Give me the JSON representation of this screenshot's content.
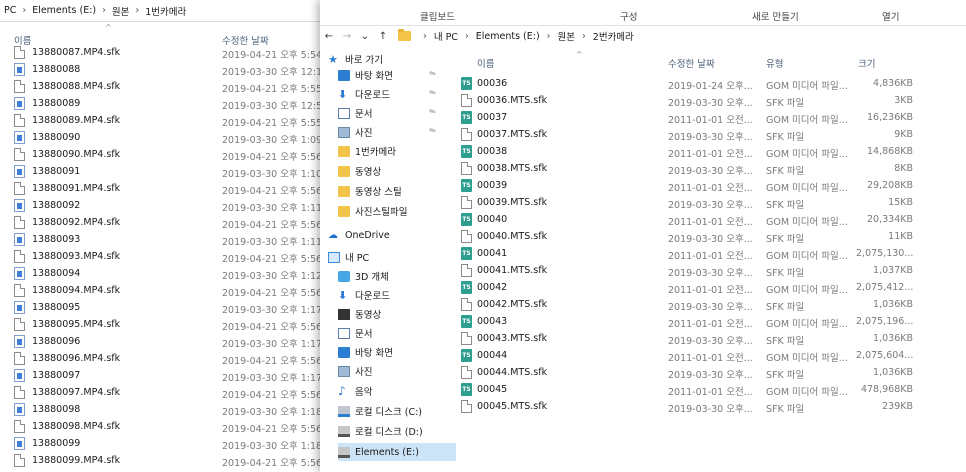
{
  "left_window": {
    "breadcrumb": [
      "PC",
      "Elements (E:)",
      "원본",
      "1번카메라"
    ],
    "columns": {
      "name": "이름",
      "date": "수정한 날짜"
    },
    "sort_arrow": "^",
    "files": [
      {
        "name": "13880087.MP4.sfk",
        "date": "2019-04-21 오후 5:54",
        "icon": "doc-icon"
      },
      {
        "name": "13880088",
        "date": "2019-03-30 오후 12:1",
        "icon": "image-icon"
      },
      {
        "name": "13880088.MP4.sfk",
        "date": "2019-04-21 오후 5:55",
        "icon": "doc-icon"
      },
      {
        "name": "13880089",
        "date": "2019-03-30 오후 12:5",
        "icon": "image-icon"
      },
      {
        "name": "13880089.MP4.sfk",
        "date": "2019-04-21 오후 5:55",
        "icon": "doc-icon"
      },
      {
        "name": "13880090",
        "date": "2019-03-30 오후 1:09",
        "icon": "image-icon"
      },
      {
        "name": "13880090.MP4.sfk",
        "date": "2019-04-21 오후 5:56",
        "icon": "doc-icon"
      },
      {
        "name": "13880091",
        "date": "2019-03-30 오후 1:10",
        "icon": "image-icon"
      },
      {
        "name": "13880091.MP4.sfk",
        "date": "2019-04-21 오후 5:56",
        "icon": "doc-icon"
      },
      {
        "name": "13880092",
        "date": "2019-03-30 오후 1:11",
        "icon": "image-icon"
      },
      {
        "name": "13880092.MP4.sfk",
        "date": "2019-04-21 오후 5:56",
        "icon": "doc-icon"
      },
      {
        "name": "13880093",
        "date": "2019-03-30 오후 1:11",
        "icon": "image-icon"
      },
      {
        "name": "13880093.MP4.sfk",
        "date": "2019-04-21 오후 5:56",
        "icon": "doc-icon"
      },
      {
        "name": "13880094",
        "date": "2019-03-30 오후 1:12",
        "icon": "image-icon"
      },
      {
        "name": "13880094.MP4.sfk",
        "date": "2019-04-21 오후 5:56",
        "icon": "doc-icon"
      },
      {
        "name": "13880095",
        "date": "2019-03-30 오후 1:17",
        "icon": "image-icon"
      },
      {
        "name": "13880095.MP4.sfk",
        "date": "2019-04-21 오후 5:56",
        "icon": "doc-icon"
      },
      {
        "name": "13880096",
        "date": "2019-03-30 오후 1:17",
        "icon": "image-icon"
      },
      {
        "name": "13880096.MP4.sfk",
        "date": "2019-04-21 오후 5:56",
        "icon": "doc-icon"
      },
      {
        "name": "13880097",
        "date": "2019-03-30 오후 1:17",
        "icon": "image-icon"
      },
      {
        "name": "13880097.MP4.sfk",
        "date": "2019-04-21 오후 5:56",
        "icon": "doc-icon"
      },
      {
        "name": "13880098",
        "date": "2019-03-30 오후 1:18",
        "icon": "image-icon"
      },
      {
        "name": "13880098.MP4.sfk",
        "date": "2019-04-21 오후 5:56",
        "icon": "doc-icon"
      },
      {
        "name": "13880099",
        "date": "2019-03-30 오후 1:18",
        "icon": "image-icon"
      },
      {
        "name": "13880099.MP4.sfk",
        "date": "2019-04-21 오후 5:56",
        "icon": "doc-icon"
      }
    ]
  },
  "right_window": {
    "ribbon_groups": [
      "클립보드",
      "구성",
      "새로 만들기",
      "열기"
    ],
    "nav_buttons": {
      "back": "←",
      "forward": "→",
      "dropdown": "⌄",
      "up": "↑"
    },
    "breadcrumb": [
      "내 PC",
      "Elements (E:)",
      "원본",
      "2번카메라"
    ],
    "columns": {
      "name": "이름",
      "date": "수정한 날짜",
      "type": "유형",
      "size": "크기"
    },
    "sort_arrow": "^",
    "nav_pane": [
      {
        "label": "바로 가기",
        "icon": "star-icon",
        "indent": 0,
        "pinned": false
      },
      {
        "label": "바탕 화면",
        "icon": "desktop-icon",
        "indent": 1,
        "pinned": true
      },
      {
        "label": "다운로드",
        "icon": "download-icon",
        "indent": 1,
        "pinned": true
      },
      {
        "label": "문서",
        "icon": "documents-icon",
        "indent": 1,
        "pinned": true
      },
      {
        "label": "사진",
        "icon": "pictures-icon",
        "indent": 1,
        "pinned": true
      },
      {
        "label": "1번카메라",
        "icon": "folder-icon",
        "indent": 1,
        "pinned": false
      },
      {
        "label": "동영상",
        "icon": "folder-icon",
        "indent": 1,
        "pinned": false
      },
      {
        "label": "동영상 스틸",
        "icon": "folder-icon",
        "indent": 1,
        "pinned": false
      },
      {
        "label": "사진스틸파일",
        "icon": "folder-icon",
        "indent": 1,
        "pinned": false
      },
      {
        "label": "OneDrive",
        "icon": "onedrive-icon",
        "indent": 0,
        "pinned": false
      },
      {
        "label": "내 PC",
        "icon": "pc-icon",
        "indent": 0,
        "pinned": false
      },
      {
        "label": "3D 개체",
        "icon": "3d-objects-icon",
        "indent": 1,
        "pinned": false
      },
      {
        "label": "다운로드",
        "icon": "download-icon",
        "indent": 1,
        "pinned": false
      },
      {
        "label": "동영상",
        "icon": "videos-icon",
        "indent": 1,
        "pinned": false
      },
      {
        "label": "문서",
        "icon": "documents-icon",
        "indent": 1,
        "pinned": false
      },
      {
        "label": "바탕 화면",
        "icon": "desktop-icon",
        "indent": 1,
        "pinned": false
      },
      {
        "label": "사진",
        "icon": "pictures-icon",
        "indent": 1,
        "pinned": false
      },
      {
        "label": "음악",
        "icon": "music-icon",
        "indent": 1,
        "pinned": false
      },
      {
        "label": "로컬 디스크 (C:)",
        "icon": "drive-c-icon",
        "indent": 1,
        "pinned": false
      },
      {
        "label": "로컬 디스크 (D:)",
        "icon": "drive-icon",
        "indent": 1,
        "pinned": false
      },
      {
        "label": "Elements (E:)",
        "icon": "drive-icon",
        "indent": 1,
        "pinned": false,
        "selected": true
      }
    ],
    "files": [
      {
        "name": "00036",
        "date": "2019-01-24 오후...",
        "type": "GOM 미디어 파일...",
        "size": "4,836KB",
        "icon": "ts-icon"
      },
      {
        "name": "00036.MTS.sfk",
        "date": "2019-03-30 오후...",
        "type": "SFK 파일",
        "size": "3KB",
        "icon": "doc-icon"
      },
      {
        "name": "00037",
        "date": "2011-01-01 오전...",
        "type": "GOM 미디어 파일...",
        "size": "16,236KB",
        "icon": "ts-icon"
      },
      {
        "name": "00037.MTS.sfk",
        "date": "2019-03-30 오후...",
        "type": "SFK 파일",
        "size": "9KB",
        "icon": "doc-icon"
      },
      {
        "name": "00038",
        "date": "2011-01-01 오전...",
        "type": "GOM 미디어 파일...",
        "size": "14,868KB",
        "icon": "ts-icon"
      },
      {
        "name": "00038.MTS.sfk",
        "date": "2019-03-30 오후...",
        "type": "SFK 파일",
        "size": "8KB",
        "icon": "doc-icon"
      },
      {
        "name": "00039",
        "date": "2011-01-01 오전...",
        "type": "GOM 미디어 파일...",
        "size": "29,208KB",
        "icon": "ts-icon"
      },
      {
        "name": "00039.MTS.sfk",
        "date": "2019-03-30 오후...",
        "type": "SFK 파일",
        "size": "15KB",
        "icon": "doc-icon"
      },
      {
        "name": "00040",
        "date": "2011-01-01 오전...",
        "type": "GOM 미디어 파일...",
        "size": "20,334KB",
        "icon": "ts-icon"
      },
      {
        "name": "00040.MTS.sfk",
        "date": "2019-03-30 오후...",
        "type": "SFK 파일",
        "size": "11KB",
        "icon": "doc-icon"
      },
      {
        "name": "00041",
        "date": "2011-01-01 오전...",
        "type": "GOM 미디어 파일...",
        "size": "2,075,130...",
        "icon": "ts-icon"
      },
      {
        "name": "00041.MTS.sfk",
        "date": "2019-03-30 오후...",
        "type": "SFK 파일",
        "size": "1,037KB",
        "icon": "doc-icon"
      },
      {
        "name": "00042",
        "date": "2011-01-01 오전...",
        "type": "GOM 미디어 파일...",
        "size": "2,075,412...",
        "icon": "ts-icon"
      },
      {
        "name": "00042.MTS.sfk",
        "date": "2019-03-30 오후...",
        "type": "SFK 파일",
        "size": "1,036KB",
        "icon": "doc-icon"
      },
      {
        "name": "00043",
        "date": "2011-01-01 오전...",
        "type": "GOM 미디어 파일...",
        "size": "2,075,196...",
        "icon": "ts-icon"
      },
      {
        "name": "00043.MTS.sfk",
        "date": "2019-03-30 오후...",
        "type": "SFK 파일",
        "size": "1,036KB",
        "icon": "doc-icon"
      },
      {
        "name": "00044",
        "date": "2011-01-01 오전...",
        "type": "GOM 미디어 파일...",
        "size": "2,075,604...",
        "icon": "ts-icon"
      },
      {
        "name": "00044.MTS.sfk",
        "date": "2019-03-30 오후...",
        "type": "SFK 파일",
        "size": "1,036KB",
        "icon": "doc-icon"
      },
      {
        "name": "00045",
        "date": "2011-01-01 오전...",
        "type": "GOM 미디어 파일...",
        "size": "478,968KB",
        "icon": "ts-icon"
      },
      {
        "name": "00045.MTS.sfk",
        "date": "2019-03-30 오후...",
        "type": "SFK 파일",
        "size": "239KB",
        "icon": "doc-icon"
      }
    ],
    "ts_icon_text": "TS",
    "pin_glyph": "📌"
  }
}
